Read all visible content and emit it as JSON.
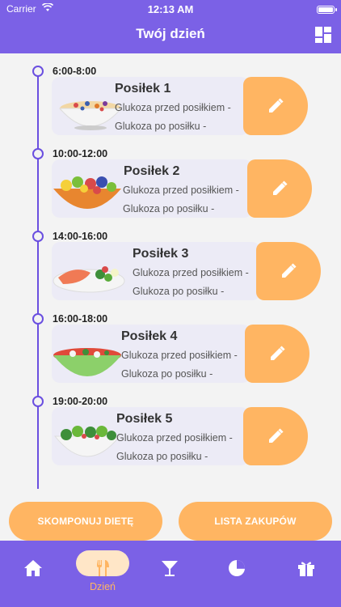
{
  "status_bar": {
    "carrier": "Carrier",
    "time": "12:13 AM"
  },
  "header": {
    "title": "Twój dzień"
  },
  "meals": [
    {
      "time": "6:00-8:00",
      "title": "Posiłek 1",
      "glucose_before": "Glukoza przed posiłkiem -",
      "glucose_after": "Glukoza po posiłku -"
    },
    {
      "time": "10:00-12:00",
      "title": "Posiłek 2",
      "glucose_before": "Glukoza przed posiłkiem -",
      "glucose_after": "Glukoza po posiłku -"
    },
    {
      "time": "14:00-16:00",
      "title": "Posiłek 3",
      "glucose_before": "Glukoza przed posiłkiem -",
      "glucose_after": "Glukoza po posiłku -"
    },
    {
      "time": "16:00-18:00",
      "title": "Posiłek 4",
      "glucose_before": "Glukoza przed posiłkiem -",
      "glucose_after": "Glukoza po posiłku -"
    },
    {
      "time": "19:00-20:00",
      "title": "Posiłek 5",
      "glucose_before": "Glukoza przed posiłkiem -",
      "glucose_after": "Glukoza po posiłku -"
    }
  ],
  "actions": {
    "compose_diet": "SKOMPONUJ DIETĘ",
    "shopping_list": "LISTA ZAKUPÓW"
  },
  "tabbar": {
    "active_label": "Dzień",
    "tabs": [
      "home-icon",
      "fork-knife-icon",
      "cocktail-icon",
      "pie-chart-icon",
      "gift-icon"
    ]
  },
  "colors": {
    "primary": "#7b61e6",
    "accent": "#ffb562",
    "card": "#ecebf6"
  }
}
